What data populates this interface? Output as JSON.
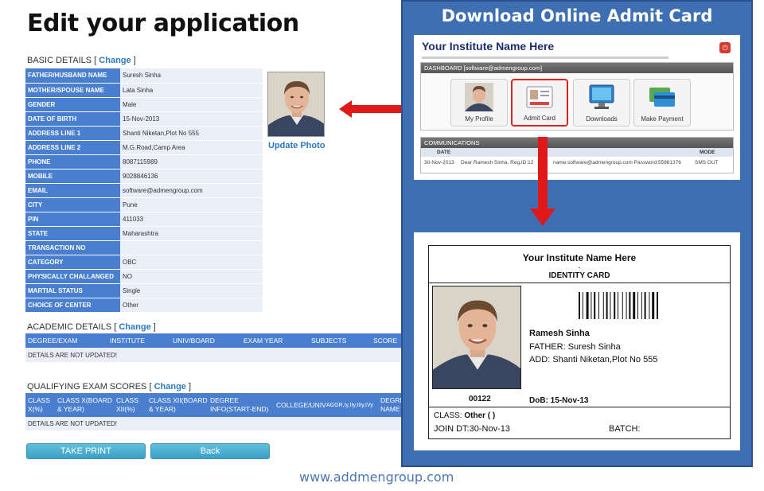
{
  "left": {
    "title": "Edit your application",
    "basic": {
      "heading": "BASIC DETAILS",
      "change": "Change",
      "rows": [
        {
          "label": "FATHER/HUSBAND NAME",
          "value": "Suresh Sinha"
        },
        {
          "label": "MOTHER/SPOUSE NAME",
          "value": "Lata Sinha"
        },
        {
          "label": "GENDER",
          "value": "Male"
        },
        {
          "label": "DATE OF BIRTH",
          "value": "15-Nov-2013"
        },
        {
          "label": "ADDRESS LINE 1",
          "value": "Shanti Niketan,Plot No 555"
        },
        {
          "label": "ADDRESS LINE 2",
          "value": "M.G.Road,Camp Area"
        },
        {
          "label": "PHONE",
          "value": "8087115989"
        },
        {
          "label": "MOBILE",
          "value": "9028846136"
        },
        {
          "label": "EMAIL",
          "value": "software@admengroup.com"
        },
        {
          "label": "CITY",
          "value": "Pune"
        },
        {
          "label": "PIN",
          "value": "411033"
        },
        {
          "label": "STATE",
          "value": "Maharashtra"
        },
        {
          "label": "TRANSACTION NO",
          "value": ""
        },
        {
          "label": "CATEGORY",
          "value": "OBC"
        },
        {
          "label": "PHYSICALLY CHALLANGED",
          "value": "NO"
        },
        {
          "label": "MARTIAL STATUS",
          "value": "Single"
        },
        {
          "label": "CHOICE OF CENTER",
          "value": "Other"
        }
      ]
    },
    "update_photo": "Update Photo",
    "academic": {
      "heading": "ACADEMIC DETAILS",
      "change": "Change",
      "columns": [
        "DEGREE/EXAM",
        "INSTITUTE",
        "UNIV/BOARD",
        "EXAM YEAR",
        "SUBJECTS",
        "SCORE"
      ],
      "empty": "DETAILS ARE NOT UPDATED!"
    },
    "qualifying": {
      "heading": "QUALIFYING EXAM SCORES",
      "change": "Change",
      "col1a": "CLASS",
      "col1b": "X(%)",
      "col2a": "CLASS X(BOARD",
      "col2b": "& YEAR)",
      "col3a": "CLASS",
      "col3b": "XII(%)",
      "col4a": "CLASS XII(BOARD",
      "col4b": "& YEAR)",
      "col5a": "DEGREE",
      "col5b": "INFO(START-END)",
      "col6": "COLLEGE/UNIV",
      "col7": "AGGR,Iy,IIy,IIIy,IVy",
      "col8a": "DEGRI",
      "col8b": "NAME",
      "empty": "DETAILS ARE NOT UPDATED!"
    },
    "take_print": "TAKE PRINT",
    "back": "Back"
  },
  "footer_url": "www.addmengroup.com",
  "right": {
    "title": "Download Online Admit Card",
    "dashboard": {
      "institute": "Your Institute Name Here",
      "header": "DASHBOARD [software@admengroup.com]",
      "tiles": [
        "My Profile",
        "Admit Card",
        "Downloads",
        "Make Payment"
      ],
      "comm_header": "COMMUNICATIONS",
      "col_date": "DATE",
      "col_mode": "MODE",
      "row_date": "30-Nov-2013",
      "row_msg": "Dear Ramesh Sinha, Reg.ID:12",
      "row_msg2": "name:software@admengroup.com Password:55861376",
      "row_mode": "SMS OUT"
    },
    "card": {
      "institute": "Your Institute Name Here",
      "dash": "-",
      "title": "IDENTITY CARD",
      "name": "Ramesh Sinha",
      "father": "FATHER: Suresh Sinha",
      "address": "ADD: Shanti Niketan,Plot No 555",
      "id_no": "00122",
      "dob": "DoB: 15-Nov-13",
      "class_label": "CLASS: ",
      "class_value": "Other ( )",
      "join": "JOIN DT:30-Nov-13",
      "batch": "BATCH:"
    }
  },
  "colors": {
    "accent": "#4a7fd0",
    "panel": "#3e6fb2",
    "arrow": "#e01818",
    "link": "#2a7ac0"
  }
}
